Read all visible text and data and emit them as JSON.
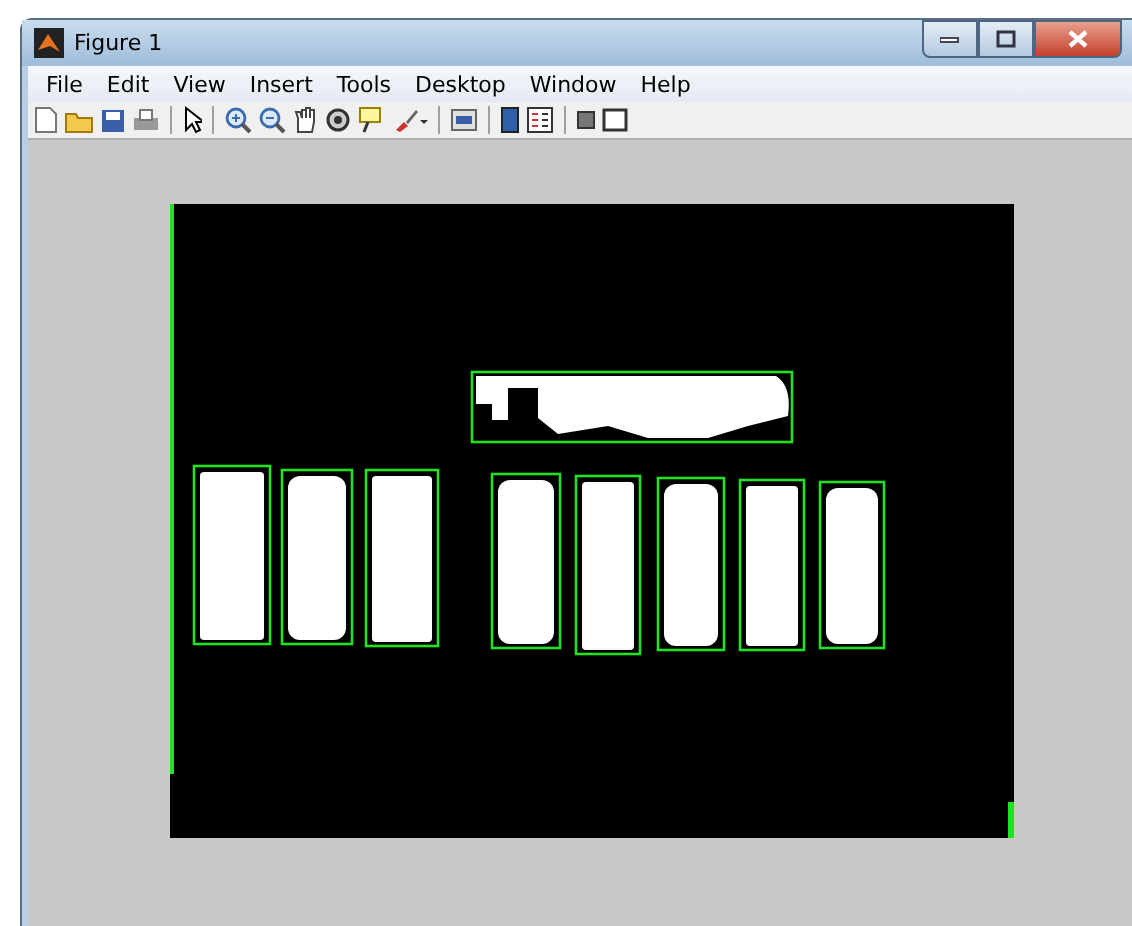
{
  "window": {
    "title": "Figure 1"
  },
  "menu": [
    "File",
    "Edit",
    "View",
    "Insert",
    "Tools",
    "Desktop",
    "Window",
    "Help"
  ]
}
